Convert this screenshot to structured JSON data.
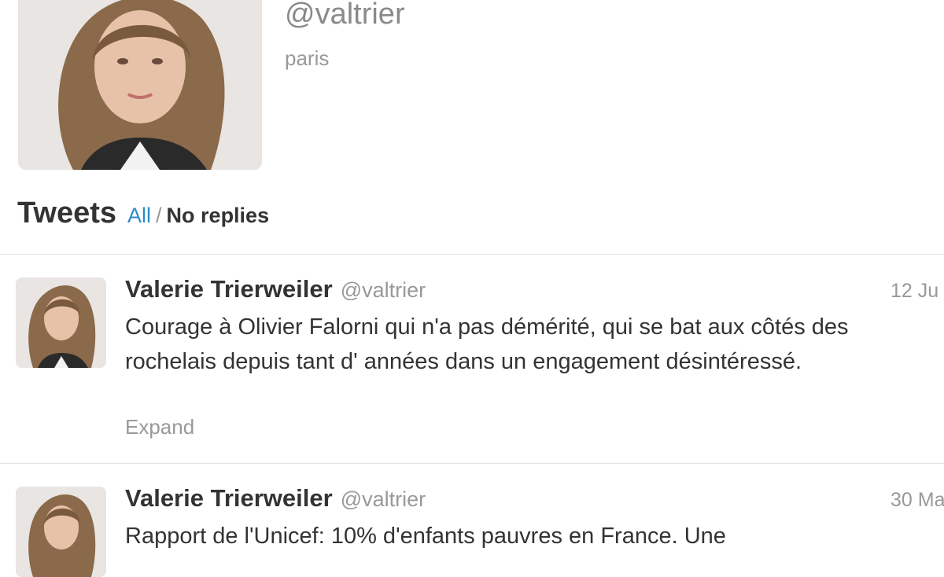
{
  "profile": {
    "handle": "@valtrier",
    "location": "paris"
  },
  "tweets_header": {
    "title": "Tweets",
    "filter_all": "All",
    "filter_separator": "/",
    "filter_no_replies": "No replies"
  },
  "tweets": [
    {
      "name": "Valerie Trierweiler",
      "handle": "@valtrier",
      "time": "12 Ju",
      "text": "Courage à Olivier Falorni qui n'a pas démérité, qui se bat aux côtés des rochelais depuis tant d' années dans un engagement désintéressé.",
      "expand_label": "Expand"
    },
    {
      "name": "Valerie Trierweiler",
      "handle": "@valtrier",
      "time": "30 Ma",
      "text": "Rapport de l'Unicef: 10% d'enfants pauvres en France. Une"
    }
  ],
  "colors": {
    "text": "#333333",
    "muted": "#999999",
    "link": "#2b8cc4",
    "divider": "#e3e3e3"
  }
}
